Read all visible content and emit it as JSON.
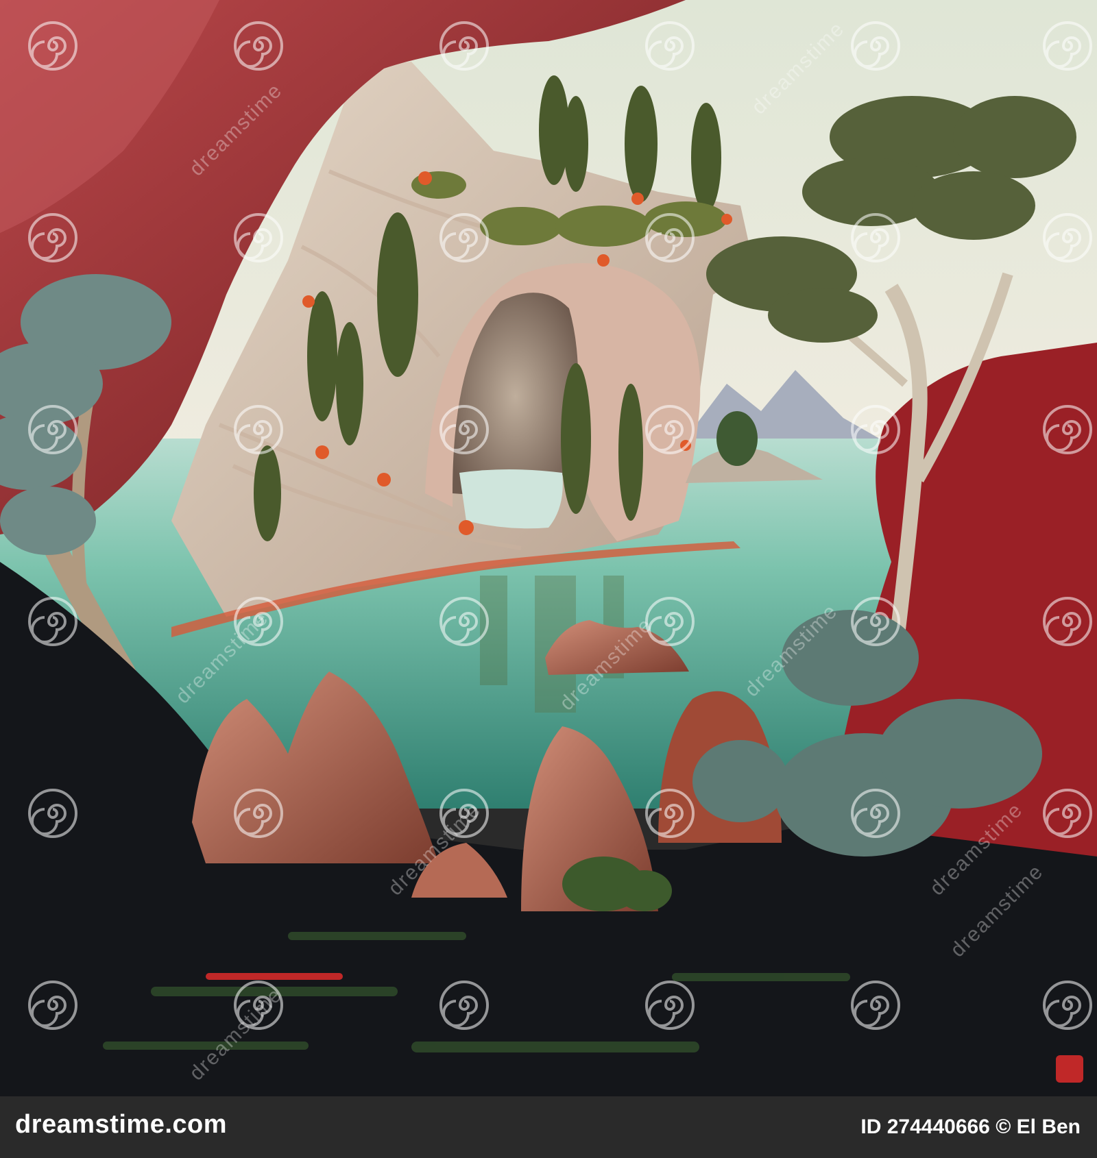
{
  "image": {
    "subject": "painting",
    "palette": {
      "sky": "#e8ead8",
      "water_light": "#8fd0bd",
      "water_deep": "#3a8f7e",
      "red_rock": "#9a2b2b",
      "pale_cliff": "#d9c8b6",
      "cypress": "#4a5a2c",
      "dark_ground": "#14161a"
    }
  },
  "watermark": {
    "text": "dreamstime",
    "icon": "spiral-icon"
  },
  "footer": {
    "brand": "dreamstime.com",
    "id_text": "ID 274440666 © El Ben",
    "background": "#2a2a2a"
  }
}
